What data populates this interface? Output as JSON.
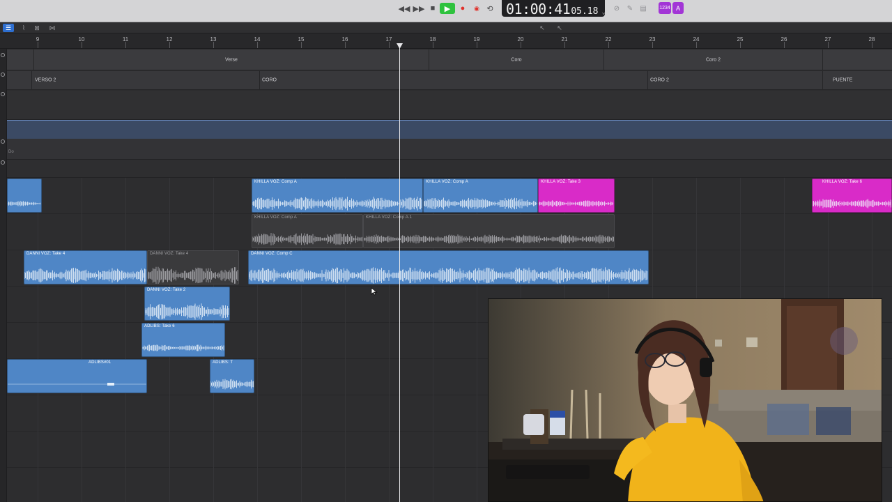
{
  "transport": {
    "time_main": "01:00:41",
    "time_frames": "05.18",
    "time_caret": "⌄",
    "rewind_icon": "◀◀",
    "forward_icon": "▶▶",
    "stop_icon": "■",
    "play_icon": "▶",
    "record_icon": "●",
    "cycle_icon": "⟲",
    "pill_left": "1234",
    "pill_right": "A",
    "accent": "#2ec23e",
    "record_color": "#e0302a",
    "pill_color": "#a235d6"
  },
  "ruler": {
    "bars": [
      "9",
      "10",
      "11",
      "12",
      "13",
      "14",
      "15",
      "16",
      "17",
      "18",
      "19",
      "20",
      "21",
      "22",
      "23",
      "24",
      "25",
      "26",
      "27",
      "28"
    ]
  },
  "arrangement": {
    "sections": [
      "Verse",
      "Coro",
      "Coro 2"
    ]
  },
  "markers": [
    "VERSO 2",
    "CORO",
    "CORO 2",
    "PUENTE"
  ],
  "global_track": {
    "label": "Do"
  },
  "regions": {
    "khilla_comp_a_1": "KHILLA VOZ: Comp A",
    "khilla_comp_a_2": "KHILLA VOZ: Comp A",
    "khilla_take3": "KHILLA VOZ: Take 3",
    "khilla_take6": "KHILLA VOZ: Take 6",
    "khilla_comp_a_gray": "KHILLA VOZ: Comp A",
    "khilla_comp_a1_gray": "KHILLA VOZ: Comp A.1",
    "danni_take4": "DANNI VOZ: Take 4",
    "danni_take4_gray": "DANNI VOZ: Take 4",
    "danni_comp_c": "DANNI VOZ: Comp C",
    "danni_take2": "DANNI VOZ: Take 2",
    "adlibs_take6": "ADLIBS: Take 6",
    "adlibs_01": "ADLIBS#01",
    "adlibs_t": "ADLIBS: T"
  },
  "colors": {
    "region_blue": "#4f86c6",
    "region_pink": "#d92bc8",
    "tempo_band": "#3b4a64"
  }
}
